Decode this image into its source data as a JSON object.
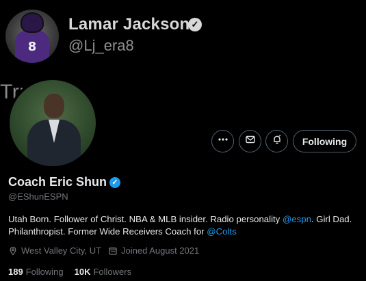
{
  "banner": {
    "name": "Lamar Jackson",
    "handle": "@Lj_era8",
    "text": "Trump",
    "avatar_number": "8"
  },
  "profile": {
    "display_name": "Coach Eric Shun",
    "handle": "@EShunESPN",
    "bio": {
      "part1": "Utah Born. Follower of Christ. NBA & MLB insider. Radio personality ",
      "mention1": "@espn",
      "part2": ". Girl Dad. Philanthropist. Former Wide Receivers Coach for ",
      "mention2": "@Colts"
    },
    "location": "West Valley City, UT",
    "joined": "Joined August 2021",
    "following_count": "189",
    "following_label": "Following",
    "followers_count": "10K",
    "followers_label": "Followers"
  },
  "actions": {
    "more_icon": "more-icon",
    "message_icon": "message-icon",
    "notify_icon": "notification-bell-icon",
    "follow_label": "Following"
  },
  "colors": {
    "accent": "#1d9bf0",
    "border": "#536471",
    "muted": "#71767b"
  }
}
